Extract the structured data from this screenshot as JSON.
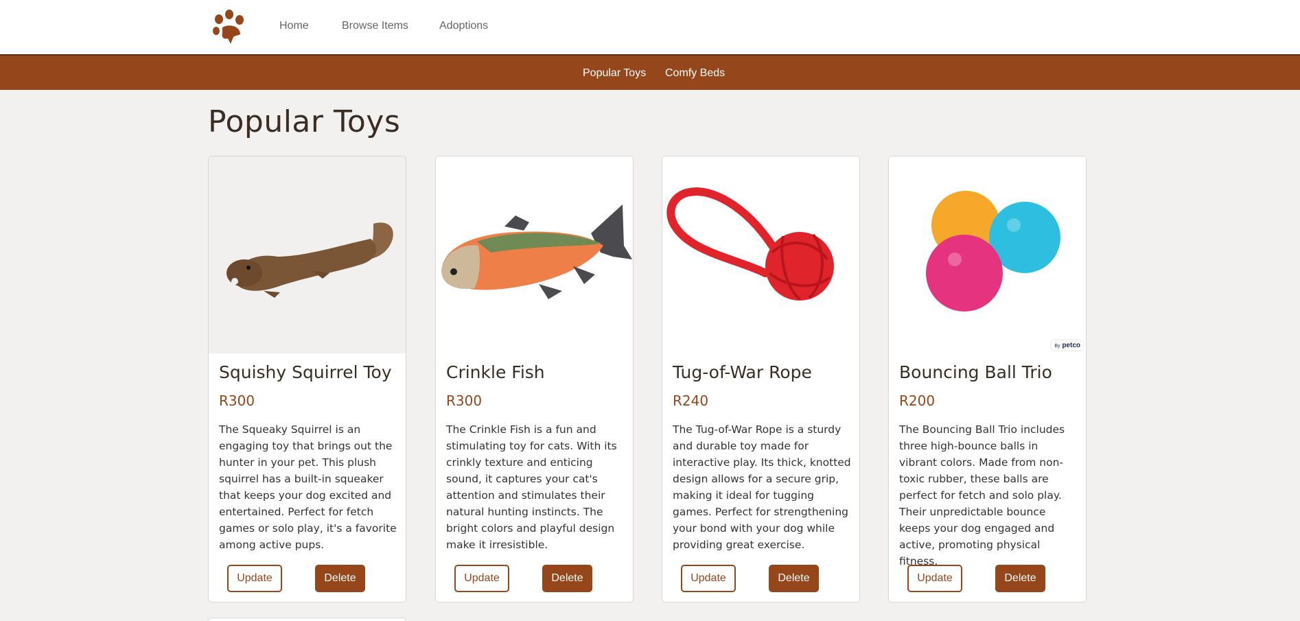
{
  "nav": {
    "logo_icon": "paw-icon",
    "links": [
      "Home",
      "Browse Items",
      "Adoptions"
    ]
  },
  "subnav": {
    "links": [
      "Popular Toys",
      "Comfy Beds"
    ]
  },
  "page": {
    "title": "Popular Toys"
  },
  "colors": {
    "brand": "#96461b",
    "background": "#f3f1ef"
  },
  "products": [
    {
      "name": "Squishy Squirrel Toy",
      "price": "R300",
      "description": "The Squeaky Squirrel is an engaging toy that brings out the hunter in your pet. This plush squirrel has a built-in squeaker that keeps your dog excited and entertained. Perfect for fetch games or solo play, it's a favorite among active pups.",
      "image": "squirrel-toy-image",
      "update_label": "Update",
      "delete_label": "Delete"
    },
    {
      "name": "Crinkle Fish",
      "price": "R300",
      "description": "The Crinkle Fish is a fun and stimulating toy for cats. With its crinkly texture and enticing sound, it captures your cat's attention and stimulates their natural hunting instincts. The bright colors and playful design make it irresistible.",
      "image": "fish-toy-image",
      "update_label": "Update",
      "delete_label": "Delete"
    },
    {
      "name": "Tug-of-War Rope",
      "price": "R240",
      "description": "The Tug-of-War Rope is a sturdy and durable toy made for interactive play. Its thick, knotted design allows for a secure grip, making it ideal for tugging games. Perfect for strengthening your bond with your dog while providing great exercise.",
      "image": "rope-toy-image",
      "update_label": "Update",
      "delete_label": "Delete"
    },
    {
      "name": "Bouncing Ball Trio",
      "price": "R200",
      "description": "The Bouncing Ball Trio includes three high-bounce balls in vibrant colors. Made from non-toxic rubber, these balls are perfect for fetch and solo play. Their unpredictable bounce keeps your dog engaged and active, promoting physical fitness.",
      "image": "balls-toy-image",
      "watermark_prefix": "By",
      "watermark_brand": "petco",
      "update_label": "Update",
      "delete_label": "Delete"
    }
  ]
}
